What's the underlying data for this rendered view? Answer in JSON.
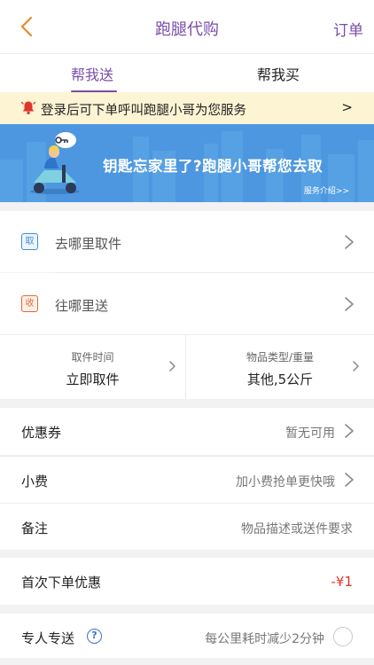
{
  "header": {
    "title": "跑腿代购",
    "orders_label": "订单"
  },
  "tabs": [
    {
      "label": "帮我送",
      "active": true
    },
    {
      "label": "帮我买",
      "active": false
    }
  ],
  "notice": {
    "text": "登录后可下单呼叫跑腿小哥为您服务",
    "arrow": ">"
  },
  "banner": {
    "slogan": "钥匙忘家里了?跑腿小哥帮您去取",
    "link": "服务介绍>>"
  },
  "address": {
    "pickup": {
      "tag": "取",
      "label": "去哪里取件"
    },
    "deliver": {
      "tag": "收",
      "label": "往哪里送"
    }
  },
  "options": {
    "time": {
      "label": "取件时间",
      "value": "立即取件"
    },
    "item": {
      "label": "物品类型/重量",
      "value": "其他,5公斤"
    }
  },
  "rows": {
    "coupon": {
      "label": "优惠券",
      "value": "暂无可用"
    },
    "tip": {
      "label": "小费",
      "value": "加小费抢单更快哦"
    },
    "note": {
      "label": "备注",
      "value": "物品描述或送件要求"
    },
    "first_order": {
      "label": "首次下单优惠",
      "value": "-¥1"
    },
    "express": {
      "label": "专人专送",
      "value": "每公里耗时减少2分钟",
      "help": "?"
    }
  },
  "colors": {
    "accent": "#7a4ea8",
    "banner": "#4c97e0",
    "notice_bg": "#fdf4d4",
    "discount": "#e0342b"
  }
}
